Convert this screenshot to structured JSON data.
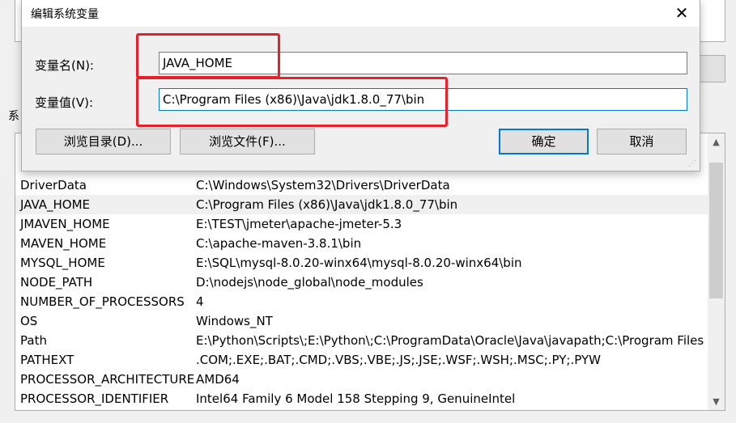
{
  "background": {
    "section_label": "系",
    "list_rows": [
      {
        "name": "DriverData",
        "value": "C:\\Windows\\System32\\Drivers\\DriverData"
      },
      {
        "name": "JAVA_HOME",
        "value": "C:\\Program Files (x86)\\Java\\jdk1.8.0_77\\bin",
        "selected": true
      },
      {
        "name": "JMAVEN_HOME",
        "value": "E:\\TEST\\jmeter\\apache-jmeter-5.3"
      },
      {
        "name": "MAVEN_HOME",
        "value": "C:\\apache-maven-3.8.1\\bin"
      },
      {
        "name": "MYSQL_HOME",
        "value": "E:\\SQL\\mysql-8.0.20-winx64\\mysql-8.0.20-winx64\\bin"
      },
      {
        "name": "NODE_PATH",
        "value": "D:\\nodejs\\node_global\\node_modules"
      },
      {
        "name": "NUMBER_OF_PROCESSORS",
        "value": "4"
      },
      {
        "name": "OS",
        "value": "Windows_NT"
      },
      {
        "name": "Path",
        "value": "E:\\Python\\Scripts\\;E:\\Python\\;C:\\ProgramData\\Oracle\\Java\\javapath;C:\\Program Files ..."
      },
      {
        "name": "PATHEXT",
        "value": ".COM;.EXE;.BAT;.CMD;.VBS;.VBE;.JS;.JSE;.WSF;.WSH;.MSC;.PY;.PYW"
      },
      {
        "name": "PROCESSOR_ARCHITECTURE",
        "value": "AMD64"
      },
      {
        "name": "PROCESSOR_IDENTIFIER",
        "value": "Intel64 Family 6 Model 158 Stepping 9, GenuineIntel"
      }
    ]
  },
  "dialog": {
    "title": "编辑系统变量",
    "close_icon": "close-icon",
    "var_name_label": "变量名(N):",
    "var_name_value": "JAVA_HOME",
    "var_value_label": "变量值(V):",
    "var_value_value": "C:\\Program Files (x86)\\Java\\jdk1.8.0_77\\bin",
    "browse_dir_label": "浏览目录(D)...",
    "browse_file_label": "浏览文件(F)...",
    "ok_label": "确定",
    "cancel_label": "取消"
  },
  "colors": {
    "annotation": "#e8202a",
    "focus": "#0078d7"
  }
}
